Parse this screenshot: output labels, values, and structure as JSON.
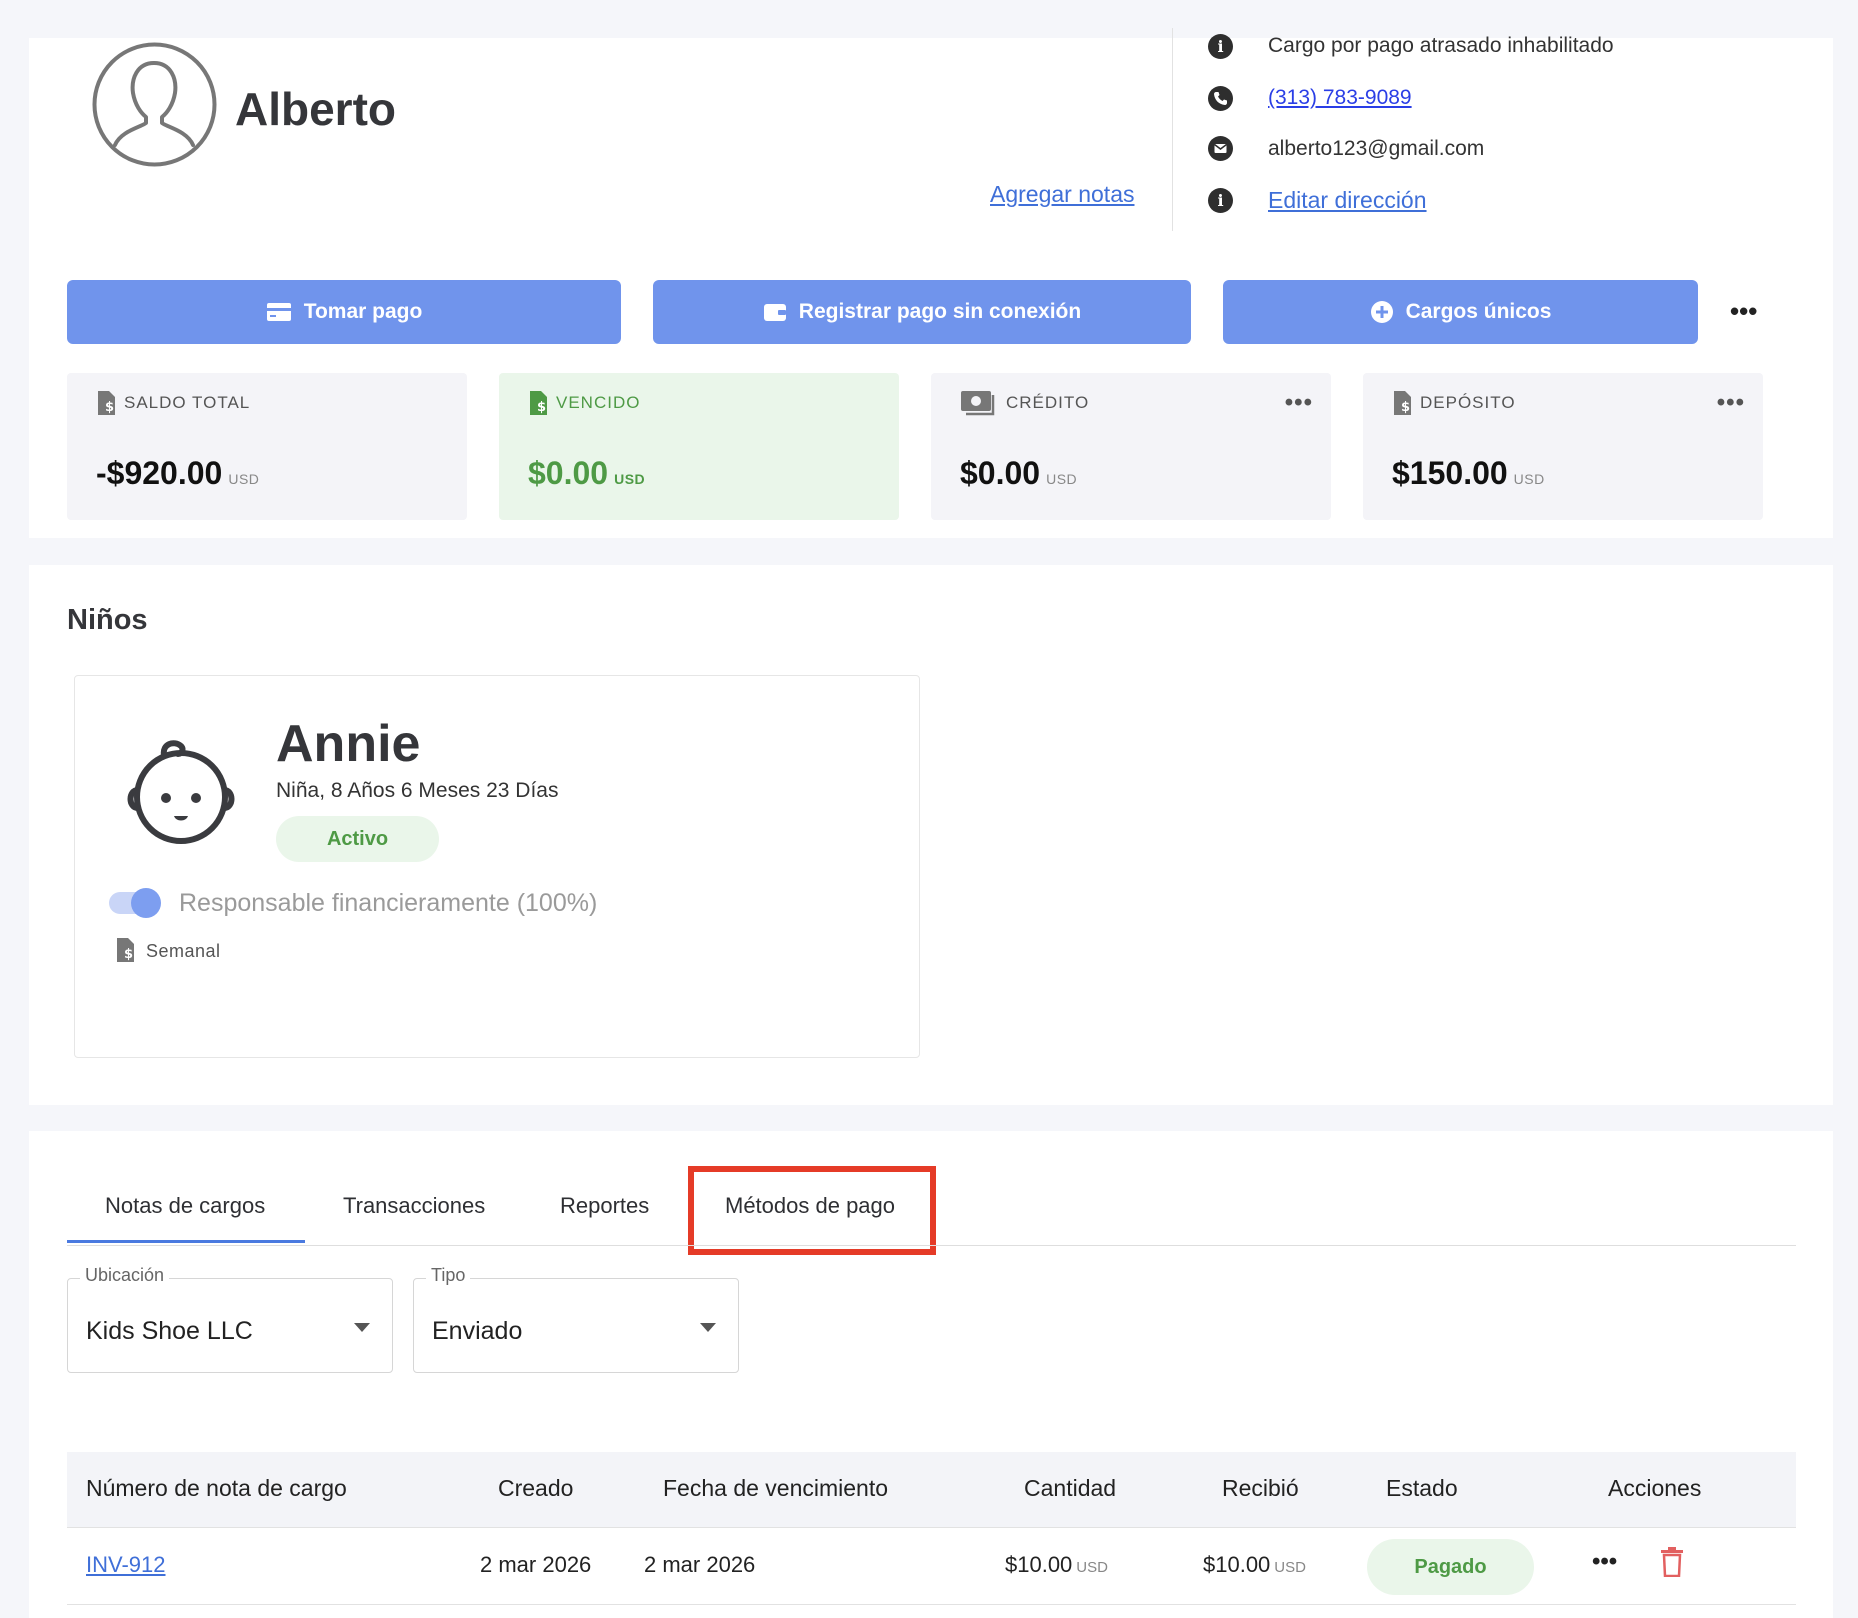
{
  "profile": {
    "name": "Alberto",
    "add_notes": "Agregar notas",
    "late_fee": "Cargo por pago atrasado inhabilitado",
    "phone": "(313) 783-9089",
    "email": "alberto123@gmail.com",
    "edit_address": "Editar dirección"
  },
  "actions": {
    "take_payment": "Tomar pago",
    "offline_payment": "Registrar pago sin conexión",
    "one_time_charges": "Cargos únicos",
    "more": "•••"
  },
  "stats": {
    "total_balance": {
      "label": "SALDO TOTAL",
      "amount": "-$920.00",
      "currency": "USD"
    },
    "overdue": {
      "label": "VENCIDO",
      "amount": "$0.00",
      "currency": "USD"
    },
    "credit": {
      "label": "CRÉDITO",
      "amount": "$0.00",
      "currency": "USD"
    },
    "deposit": {
      "label": "DEPÓSITO",
      "amount": "$150.00",
      "currency": "USD"
    },
    "more": "•••"
  },
  "children": {
    "title": "Niños",
    "child": {
      "name": "Annie",
      "details": "Niña, 8 Años 6 Meses 23 Días",
      "status": "Activo",
      "responsible": "Responsable financieramente (100%)",
      "responsible_on": true,
      "frequency": "Semanal"
    }
  },
  "tabs": [
    {
      "label": "Notas de cargos",
      "active": true
    },
    {
      "label": "Transacciones",
      "active": false
    },
    {
      "label": "Reportes",
      "active": false
    },
    {
      "label": "Métodos de pago",
      "active": false
    }
  ],
  "filters": {
    "location": {
      "label": "Ubicación",
      "value": "Kids Shoe LLC"
    },
    "type": {
      "label": "Tipo",
      "value": "Enviado"
    }
  },
  "table": {
    "headers": [
      "Número de nota de cargo",
      "Creado",
      "Fecha de vencimiento",
      "Cantidad",
      "Recibió",
      "Estado",
      "Acciones"
    ],
    "rows": [
      {
        "invoice": "INV-912",
        "created": "2 mar 2026",
        "due": "2 mar 2026",
        "amount": "$10.00",
        "amount_currency": "USD",
        "received": "$10.00",
        "received_currency": "USD",
        "status": "Pagado",
        "more": "•••"
      }
    ]
  },
  "colors": {
    "primary_button": "#7094ec",
    "link": "#3f6fd8",
    "success_green": "#4e9a45",
    "success_bg": "#eaf6ea",
    "highlight_red": "#e53b27",
    "delete_red": "#e26060"
  }
}
